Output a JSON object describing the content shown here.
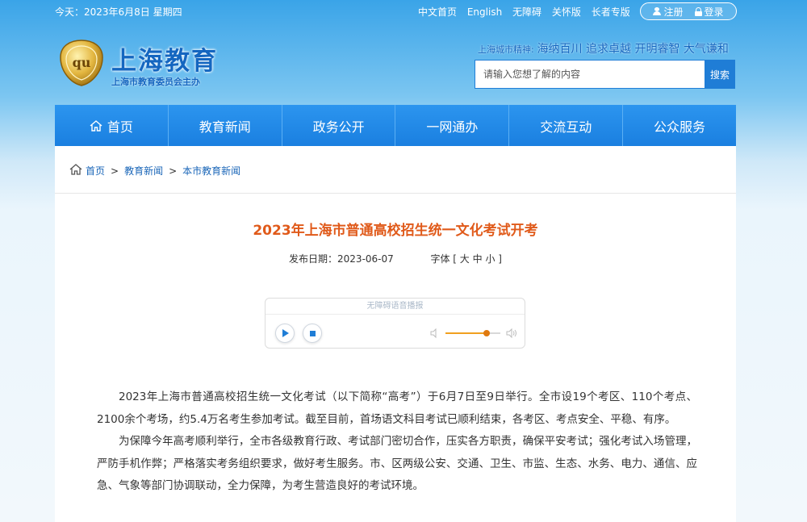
{
  "topbar": {
    "date": "今天：2023年6月8日 星期四",
    "links": [
      "中文首页",
      "English",
      "无障碍",
      "关怀版",
      "长者专版"
    ],
    "register": "注册",
    "login": "登录"
  },
  "header": {
    "title": "上海教育",
    "subtitle": "上海市教育委员会主办",
    "logo_text": "qu",
    "motto_label": "上海城市精神:",
    "motto": "海纳百川 追求卓越 开明睿智 大气谦和",
    "search_placeholder": "请输入您想了解的内容",
    "search_button": "搜索"
  },
  "nav": {
    "items": [
      "首页",
      "教育新闻",
      "政务公开",
      "一网通办",
      "交流互动",
      "公众服务"
    ]
  },
  "breadcrumb": {
    "items": [
      "首页",
      "教育新闻",
      "本市教育新闻"
    ],
    "separator": ">"
  },
  "article": {
    "title": "2023年上海市普通高校招生统一文化考试开考",
    "date_label": "发布日期：",
    "date": "2023-06-07",
    "font_label": "字体 [",
    "font_sizes": [
      "大",
      "中",
      "小"
    ],
    "font_close": "]",
    "paragraphs": [
      "2023年上海市普通高校招生统一文化考试（以下简称“高考”）于6月7日至9日举行。全市设19个考区、110个考点、2100余个考场，约5.4万名考生参加考试。截至目前，首场语文科目考试已顺利结束，各考区、考点安全、平稳、有序。",
      "为保障今年高考顺利举行，全市各级教育行政、考试部门密切合作，压实各方职责，确保平安考试；强化考试入场管理，严防手机作弊；严格落实考务组织要求，做好考生服务。市、区两级公安、交通、卫生、市监、生态、水务、电力、通信、应急、气象等部门协调联动，全力保障，为考生营造良好的考试环境。"
    ]
  },
  "player": {
    "title": "无障碍语音播报",
    "volume": 0.75
  },
  "colors": {
    "nav_blue": "#1a7fe0",
    "title_orange": "#e05a1a",
    "link_blue": "#1a66b8"
  }
}
